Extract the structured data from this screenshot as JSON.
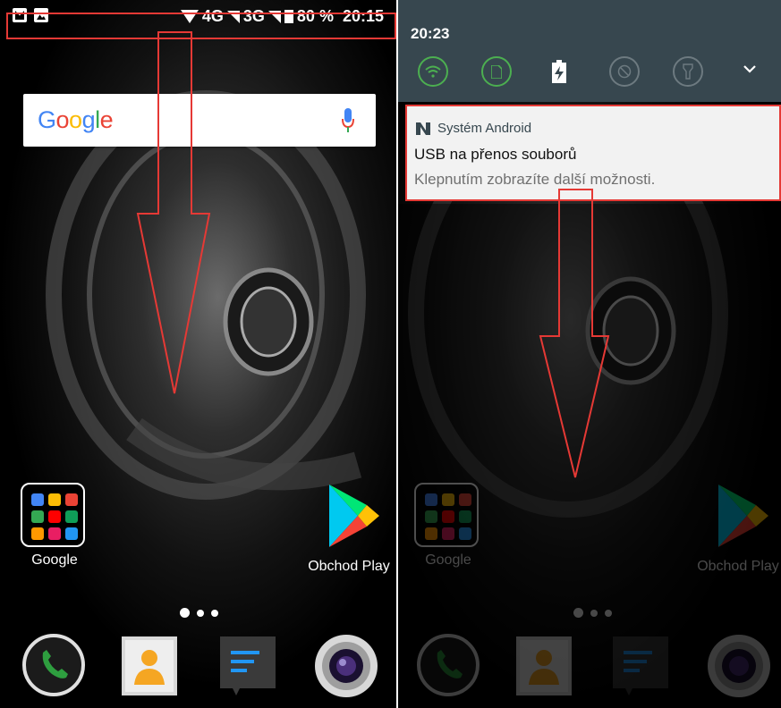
{
  "left": {
    "status_bar": {
      "network_4g": "4G",
      "network_3g": "3G",
      "battery": "80 %",
      "time": "20:15"
    },
    "search": {
      "logo": "Google"
    },
    "apps": [
      {
        "label": "Google"
      },
      {
        "label": "Obchod Play"
      }
    ]
  },
  "right": {
    "shade": {
      "time": "20:23"
    },
    "notification": {
      "app": "Systém Android",
      "title": "USB na přenos souborů",
      "text": "Klepnutím zobrazíte další možnosti."
    },
    "apps": [
      {
        "label": "Google"
      },
      {
        "label": "Obchod Play"
      }
    ]
  },
  "colors": {
    "annotation_red": "#e53935",
    "shade_bg": "#37474f",
    "phone_green": "#2e9e3f",
    "messages_blue": "#2196f3"
  },
  "icons": [
    "mail-icon",
    "image-icon",
    "wifi-icon",
    "signal-icon",
    "battery-icon",
    "mic-icon",
    "play-store-icon",
    "phone-icon",
    "contacts-icon",
    "messages-icon",
    "camera-icon",
    "chevron-down-icon",
    "flashlight-icon",
    "android-n-icon"
  ]
}
